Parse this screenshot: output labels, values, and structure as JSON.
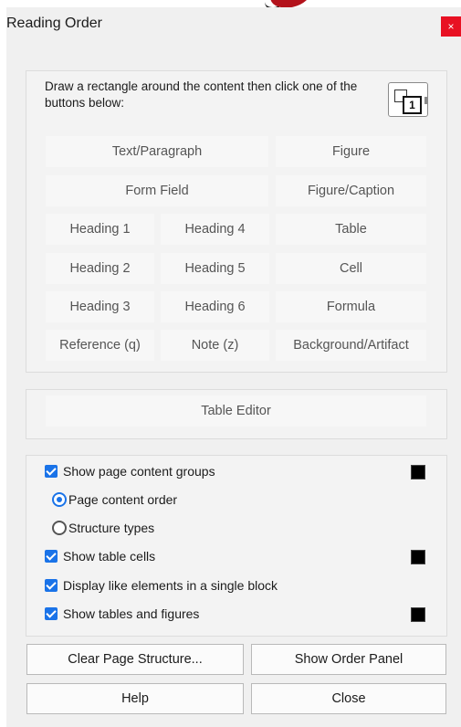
{
  "dialog": {
    "title": "Reading Order",
    "close_glyph": "×"
  },
  "instructions": "Draw a rectangle around the content then click one of the buttons below:",
  "tag_buttons": [
    "Text/Paragraph",
    "Figure",
    "Form Field",
    "Figure/Caption",
    "Heading 1",
    "Heading 4",
    "Table",
    "Heading 2",
    "Heading 5",
    "Cell",
    "Heading 3",
    "Heading 6",
    "Formula",
    "Reference (q)",
    "Note (z)",
    "Background/Artifact"
  ],
  "table_editor_label": "Table Editor",
  "options": {
    "show_page_content_groups": {
      "label": "Show page content groups",
      "checked": true,
      "swatch_color": "#000000"
    },
    "page_content_order": {
      "label": "Page content order",
      "selected": true
    },
    "structure_types": {
      "label": "Structure types",
      "selected": false
    },
    "show_table_cells": {
      "label": "Show table cells",
      "checked": true,
      "swatch_color": "#000000"
    },
    "display_like_elements": {
      "label": "Display like elements in a single block",
      "checked": true
    },
    "show_tables_and_figures": {
      "label": "Show tables and figures",
      "checked": true,
      "swatch_color": "#000000"
    }
  },
  "bottom_buttons": {
    "clear_page_structure": "Clear Page Structure...",
    "show_order_panel": "Show Order Panel",
    "help": "Help",
    "close": "Close"
  }
}
